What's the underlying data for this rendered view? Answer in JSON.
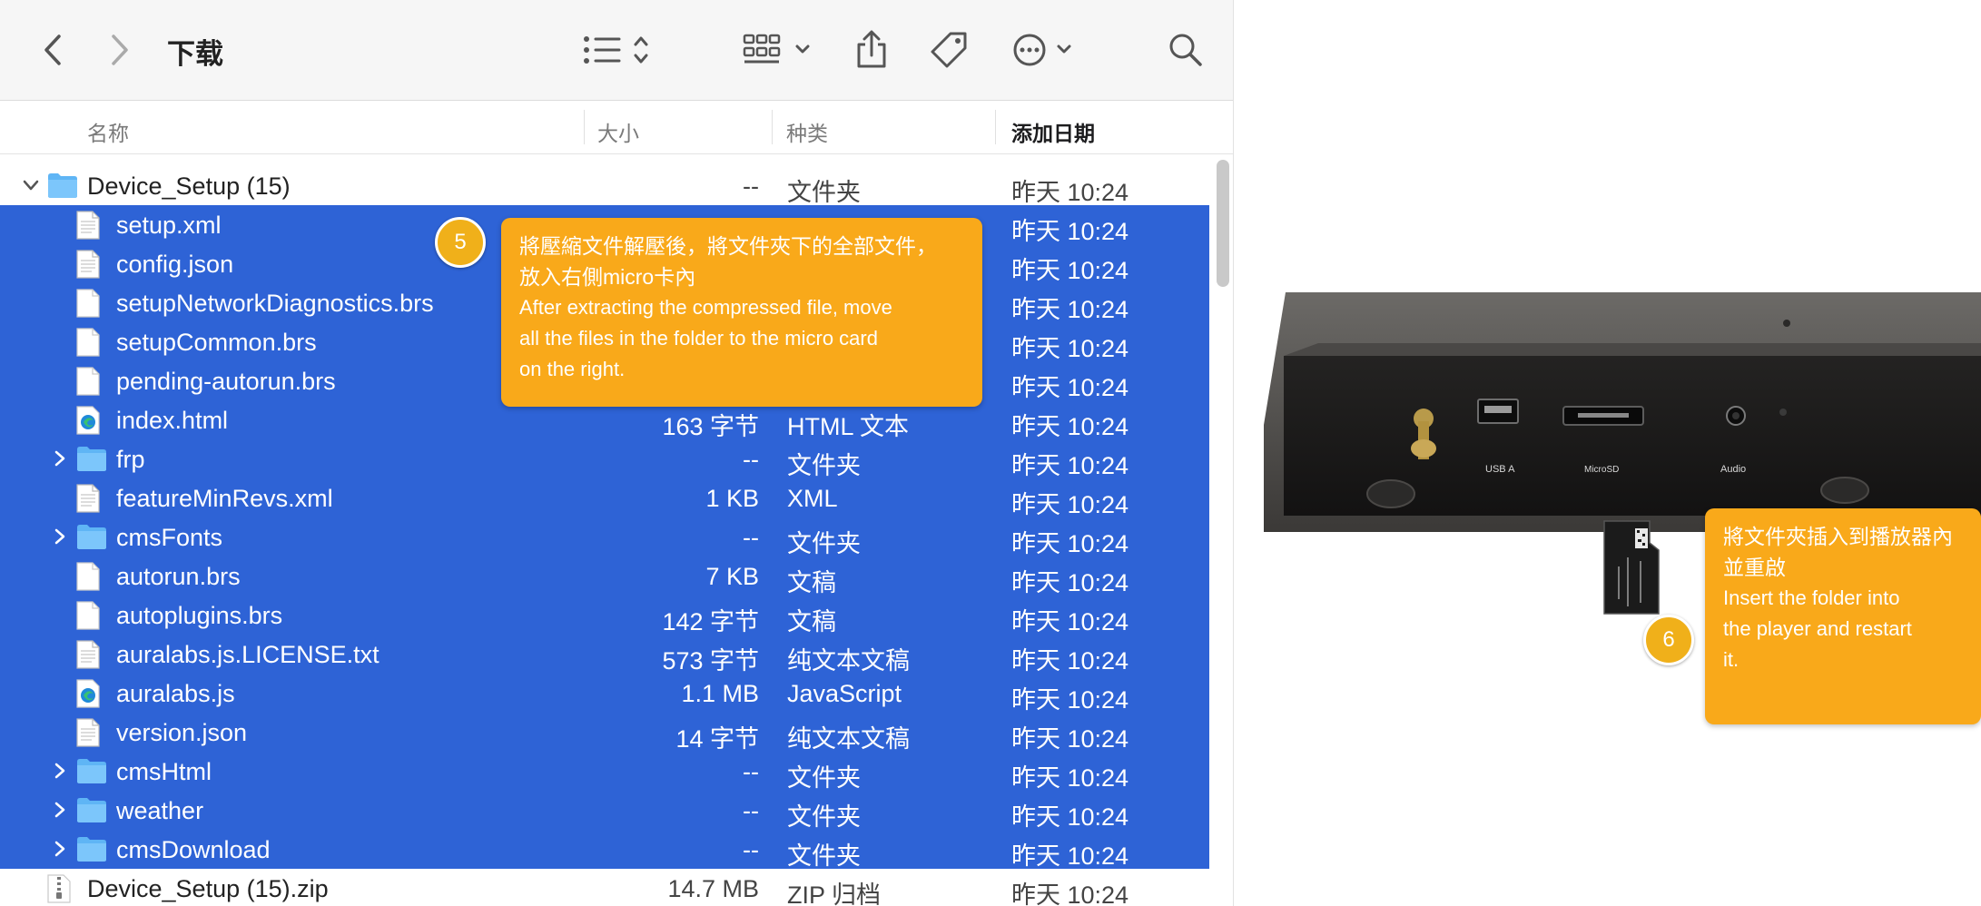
{
  "window": {
    "title": "下载"
  },
  "toolbar": {
    "back_icon": "chevron-left-icon",
    "forward_icon": "chevron-right-icon",
    "view_icon": "list-view-icon",
    "group_icon": "grid-group-icon",
    "share_icon": "share-icon",
    "tag_icon": "tag-icon",
    "more_icon": "ellipsis-circle-icon",
    "search_icon": "search-icon"
  },
  "columns": {
    "name": "名称",
    "size": "大小",
    "kind": "种类",
    "date": "添加日期"
  },
  "rows": [
    {
      "name": "Device_Setup (15)",
      "size": "--",
      "kind": "文件夹",
      "date": "昨天 10:24",
      "type": "folder",
      "expanded": true,
      "selected": false
    },
    {
      "name": "setup.xml",
      "size": "",
      "kind": "",
      "date": "昨天 10:24",
      "type": "doc",
      "selected": true
    },
    {
      "name": "config.json",
      "size": "",
      "kind": "",
      "date": "昨天 10:24",
      "type": "doc",
      "selected": true
    },
    {
      "name": "setupNetworkDiagnostics.brs",
      "size": "",
      "kind": "",
      "date": "昨天 10:24",
      "type": "blank",
      "selected": true
    },
    {
      "name": "setupCommon.brs",
      "size": "",
      "kind": "",
      "date": "昨天 10:24",
      "type": "blank",
      "selected": true
    },
    {
      "name": "pending-autorun.brs",
      "size": "",
      "kind": "",
      "date": "昨天 10:24",
      "type": "blank",
      "selected": true
    },
    {
      "name": "index.html",
      "size": "163 字节",
      "kind": "HTML 文本",
      "date": "昨天 10:24",
      "type": "html",
      "selected": true
    },
    {
      "name": "frp",
      "size": "--",
      "kind": "文件夹",
      "date": "昨天 10:24",
      "type": "folder",
      "selected": true
    },
    {
      "name": "featureMinRevs.xml",
      "size": "1 KB",
      "kind": "XML",
      "date": "昨天 10:24",
      "type": "doc",
      "selected": true
    },
    {
      "name": "cmsFonts",
      "size": "--",
      "kind": "文件夹",
      "date": "昨天 10:24",
      "type": "folder",
      "selected": true
    },
    {
      "name": "autorun.brs",
      "size": "7 KB",
      "kind": "文稿",
      "date": "昨天 10:24",
      "type": "blank",
      "selected": true
    },
    {
      "name": "autoplugins.brs",
      "size": "142 字节",
      "kind": "文稿",
      "date": "昨天 10:24",
      "type": "blank",
      "selected": true
    },
    {
      "name": "auralabs.js.LICENSE.txt",
      "size": "573 字节",
      "kind": "纯文本文稿",
      "date": "昨天 10:24",
      "type": "doc",
      "selected": true
    },
    {
      "name": "auralabs.js",
      "size": "1.1 MB",
      "kind": "JavaScript",
      "date": "昨天 10:24",
      "type": "html",
      "selected": true
    },
    {
      "name": "version.json",
      "size": "14 字节",
      "kind": "纯文本文稿",
      "date": "昨天 10:24",
      "type": "doc",
      "selected": true
    },
    {
      "name": "cmsHtml",
      "size": "--",
      "kind": "文件夹",
      "date": "昨天 10:24",
      "type": "folder",
      "selected": true
    },
    {
      "name": "weather",
      "size": "--",
      "kind": "文件夹",
      "date": "昨天 10:24",
      "type": "folder",
      "selected": true
    },
    {
      "name": "cmsDownload",
      "size": "--",
      "kind": "文件夹",
      "date": "昨天 10:24",
      "type": "folder",
      "selected": true
    },
    {
      "name": "Device_Setup (15).zip",
      "size": "14.7 MB",
      "kind": "ZIP 归档",
      "date": "昨天 10:24",
      "type": "zip",
      "selected": false
    }
  ],
  "callout5": {
    "number": "5",
    "zh_line1": "將壓縮文件解壓後，將文件夾下的全部文件，",
    "zh_line2": "放入右側micro卡內",
    "en_line1": "After extracting the compressed file, move",
    "en_line2": "all the files in the folder to the micro card",
    "en_line3": "on the right."
  },
  "callout6": {
    "number": "6",
    "zh_line1": "將文件夾插入到播放器內",
    "zh_line2": "並重啟",
    "en_line1": "Insert the folder into",
    "en_line2": "the player and restart",
    "en_line3": "it."
  },
  "device": {
    "port_usb": "USB A",
    "port_sd": "MicroSD",
    "port_audio": "Audio"
  },
  "colors": {
    "selection": "#2e63d6",
    "callout": "#f9a91a",
    "badge": "#f0b01a"
  }
}
